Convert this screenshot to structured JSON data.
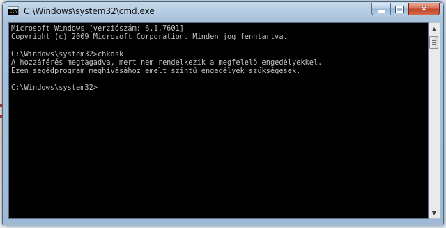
{
  "window": {
    "title": "C:\\Windows\\system32\\cmd.exe",
    "icon": "cmd-icon",
    "controls": {
      "minimize": "minimize-icon",
      "maximize": "maximize-icon",
      "close": "close-icon"
    }
  },
  "console": {
    "background": "#000000",
    "foreground": "#c0c0c0",
    "lines": [
      "Microsoft Windows [verziószám: 6.1.7601]",
      "Copyright (c) 2009 Microsoft Corporation. Minden jog fenntartva.",
      "",
      "C:\\Windows\\system32>chkdsk",
      "A hozzáférés megtagadva, mert nem rendelkezik a megfelelő engedélyekkel.",
      "Ezen segédprogram meghívásához emelt szintű engedélyek szükségesek.",
      "",
      "C:\\Windows\\system32>"
    ]
  },
  "scrollbar": {
    "up_icon": "scroll-up-arrow-icon",
    "down_icon": "scroll-down-arrow-icon"
  }
}
